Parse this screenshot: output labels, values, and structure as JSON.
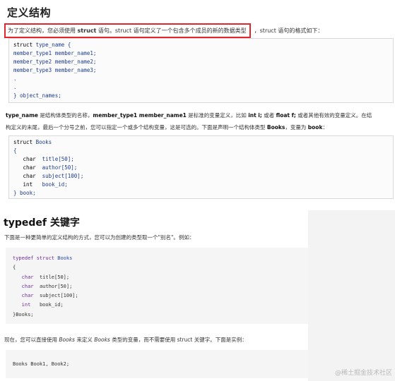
{
  "section1": {
    "title": "定义结构",
    "intro_highlight_a": "为了定义结构，您必须使用 ",
    "intro_highlight_kw": "struct",
    "intro_highlight_b": " 语句。struct 语句定义了一个包含多个成员的新的数据类型",
    "intro_rest": "，struct 语句的格式如下：",
    "code_lines": [
      "struct type_name {",
      "member_type1 member_name1;",
      "member_type2 member_name2;",
      "member_type3 member_name3;",
      ".",
      ".",
      "} object_names;"
    ],
    "desc_line1_parts": [
      "type_name",
      " 是结构体类型的名称，",
      "member_type1 member_name1",
      " 是标准的变量定义，比如 ",
      "int i;",
      " 或者 ",
      "float f;",
      " 或者其他有效的变量定义。在结"
    ],
    "desc_line2_a": "构定义的末尾，最后一个分号之前，您可以指定一个或多个结构变量，这是可选的。下面是声明一个结构体类型 ",
    "desc_line2_b": "Books",
    "desc_line2_c": "，变量为 ",
    "desc_line2_d": "book",
    "desc_line2_e": "：",
    "code2_lines": [
      "struct Books",
      "{",
      "   char  title[50];",
      "   char  author[50];",
      "   char  subject[100];",
      "   int   book_id;",
      "} book;"
    ]
  },
  "section2": {
    "title": "typedef 关键字",
    "p1": "下面是一种更简单的定义结构的方式，您可以为创建的类型取一个\"别名\"。例如：",
    "code_lines": [
      "typedef struct Books",
      "{",
      "   char  title[50];",
      "   char  author[50];",
      "   char  subject[100];",
      "   int   book_id;",
      "}Books;"
    ],
    "p2_a": "现在，您可以直接使用 ",
    "p2_b": "Books",
    "p2_c": " 来定义 ",
    "p2_d": "Books",
    "p2_e": " 类型的变量，而不需要使用 struct 关键字。下面是实例：",
    "code2": "Books Book1, Book2;"
  },
  "watermark": "@稀土掘金技术社区",
  "colors": {
    "highlight_border": "#e3262b",
    "code_blue": "#1d3b8a"
  }
}
